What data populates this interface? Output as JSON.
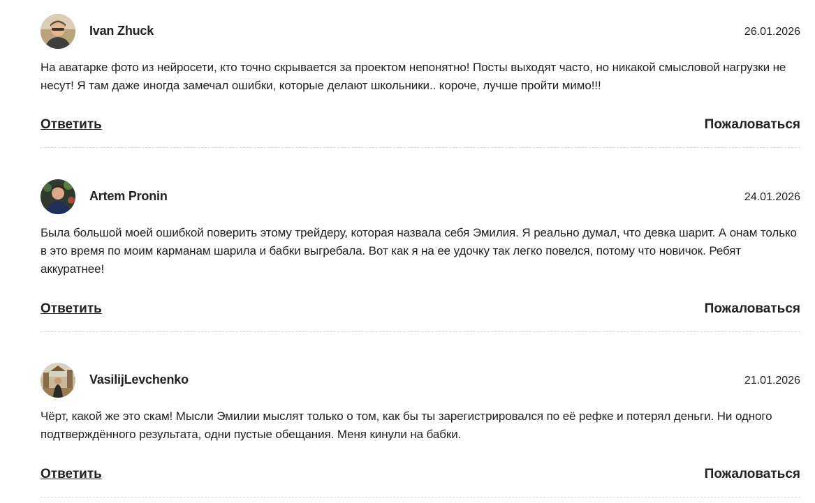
{
  "comments": [
    {
      "author": "Ivan Zhuck",
      "date": "26.01.2026",
      "text": "На аватарке фото из нейросети, кто точно скрывается за проектом непонятно! Посты выходят часто, но никакой смысловой нагрузки не несут! Я там даже иногда замечал ошибки, которые делают школьники.. короче, лучше пройти мимо!!!",
      "reply_label": "Ответить",
      "report_label": "Пожаловаться",
      "avatar_icon": "user-photo-icon"
    },
    {
      "author": "Artem Pronin",
      "date": "24.01.2026",
      "text": "Была большой моей ошибкой поверить этому трейдеру, которая назвала себя Эмилия. Я реально думал, что девка шарит. А онам только в это время по моим карманам шарила и бабки выгребала. Вот как я на ее удочку так легко повелся, потому что новичок. Ребят аккуратнее!",
      "reply_label": "Ответить",
      "report_label": "Пожаловаться",
      "avatar_icon": "user-photo-icon"
    },
    {
      "author": "VasilijLevchenko",
      "date": "21.01.2026",
      "text": "Чёрт, какой же это скам! Мысли Эмилии мыслят только о том, как бы ты зарегистрировался по её рефке и потерял деньги. Ни одного подтверждённого результата, одни пустые обещания. Меня кинули на бабки.",
      "reply_label": "Ответить",
      "report_label": "Пожаловаться",
      "avatar_icon": "user-photo-icon"
    }
  ],
  "colors": {
    "text": "#222222",
    "divider": "#d6d6d6",
    "background": "#ffffff"
  }
}
